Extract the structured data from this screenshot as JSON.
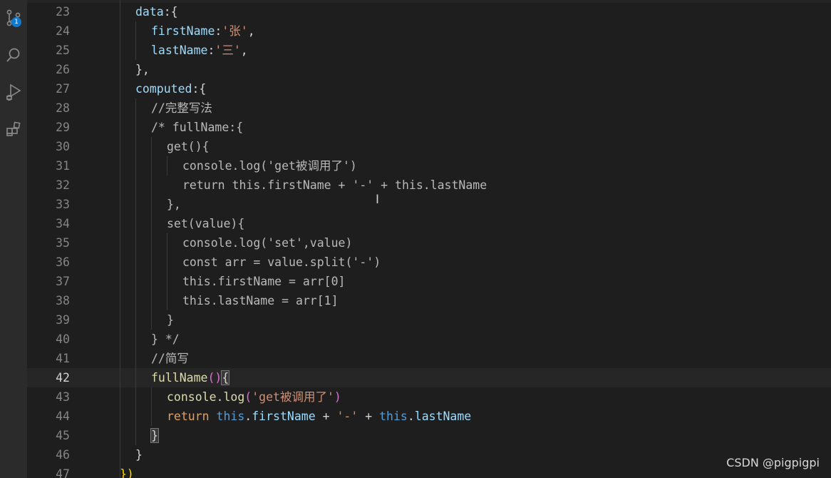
{
  "activity_bar": {
    "scm_badge": "1",
    "icons": [
      "source-control-icon",
      "search-icon",
      "run-debug-icon",
      "extensions-icon"
    ]
  },
  "editor": {
    "active_line": "42",
    "lines": [
      {
        "n": "23",
        "tokens": [
          {
            "t": "data",
            "c": "p"
          },
          {
            "t": ":{",
            "c": "pl"
          }
        ]
      },
      {
        "n": "24",
        "tokens": [
          {
            "t": "firstName",
            "c": "p"
          },
          {
            "t": ":",
            "c": "pl"
          },
          {
            "t": "'张'",
            "c": "s"
          },
          {
            "t": ",",
            "c": "pl"
          }
        ]
      },
      {
        "n": "25",
        "tokens": [
          {
            "t": "lastName",
            "c": "p"
          },
          {
            "t": ":",
            "c": "pl"
          },
          {
            "t": "'三'",
            "c": "s"
          },
          {
            "t": ",",
            "c": "pl"
          }
        ]
      },
      {
        "n": "26",
        "tokens": [
          {
            "t": "},",
            "c": "pl"
          }
        ]
      },
      {
        "n": "27",
        "tokens": [
          {
            "t": "computed",
            "c": "p"
          },
          {
            "t": ":{",
            "c": "pl"
          }
        ]
      },
      {
        "n": "28",
        "tokens": [
          {
            "t": "//完整写法",
            "c": "dim"
          }
        ]
      },
      {
        "n": "29",
        "tokens": [
          {
            "t": "/* fullName:{",
            "c": "dim"
          }
        ]
      },
      {
        "n": "30",
        "tokens": [
          {
            "t": "get(){",
            "c": "dim"
          }
        ]
      },
      {
        "n": "31",
        "tokens": [
          {
            "t": "console.log('get被调用了')",
            "c": "dim"
          }
        ]
      },
      {
        "n": "32",
        "tokens": [
          {
            "t": "return this.firstName + '-' + this.lastName",
            "c": "dim"
          }
        ]
      },
      {
        "n": "33",
        "tokens": [
          {
            "t": "},",
            "c": "dim"
          }
        ]
      },
      {
        "n": "34",
        "tokens": [
          {
            "t": "set(value){",
            "c": "dim"
          }
        ]
      },
      {
        "n": "35",
        "tokens": [
          {
            "t": "console.log('set',value)",
            "c": "dim"
          }
        ]
      },
      {
        "n": "36",
        "tokens": [
          {
            "t": "const arr = value.split('-')",
            "c": "dim"
          }
        ]
      },
      {
        "n": "37",
        "tokens": [
          {
            "t": "this.firstName = arr[0]",
            "c": "dim"
          }
        ]
      },
      {
        "n": "38",
        "tokens": [
          {
            "t": "this.lastName = arr[1]",
            "c": "dim"
          }
        ]
      },
      {
        "n": "39",
        "tokens": [
          {
            "t": "}",
            "c": "dim"
          }
        ]
      },
      {
        "n": "40",
        "tokens": [
          {
            "t": "} */",
            "c": "dim"
          }
        ]
      },
      {
        "n": "41",
        "tokens": [
          {
            "t": "//简写",
            "c": "dim"
          }
        ]
      },
      {
        "n": "42",
        "tokens": [
          {
            "t": "fullName",
            "c": "f"
          },
          {
            "t": "()",
            "c": "mg"
          },
          {
            "t": "{",
            "c": "bm"
          }
        ]
      },
      {
        "n": "43",
        "tokens": [
          {
            "t": "console",
            "c": "f"
          },
          {
            "t": ".",
            "c": "pl"
          },
          {
            "t": "log",
            "c": "f"
          },
          {
            "t": "(",
            "c": "mg"
          },
          {
            "t": "'get被调用了'",
            "c": "s"
          },
          {
            "t": ")",
            "c": "mg"
          }
        ]
      },
      {
        "n": "44",
        "tokens": [
          {
            "t": "return",
            "c": "ctl"
          },
          {
            "t": " ",
            "c": "pl"
          },
          {
            "t": "this",
            "c": "v"
          },
          {
            "t": ".",
            "c": "pl"
          },
          {
            "t": "firstName",
            "c": "p"
          },
          {
            "t": " + ",
            "c": "pl"
          },
          {
            "t": "'-'",
            "c": "s"
          },
          {
            "t": " + ",
            "c": "pl"
          },
          {
            "t": "this",
            "c": "v"
          },
          {
            "t": ".",
            "c": "pl"
          },
          {
            "t": "lastName",
            "c": "p"
          }
        ]
      },
      {
        "n": "45",
        "tokens": [
          {
            "t": "}",
            "c": "bm"
          }
        ]
      },
      {
        "n": "46",
        "tokens": [
          {
            "t": "}",
            "c": "pl"
          }
        ]
      },
      {
        "n": "47",
        "tokens": [
          {
            "t": "})",
            "c": "y"
          }
        ]
      }
    ]
  },
  "watermark": "CSDN @pigpigpi",
  "colors": {
    "background": "#1e1e1e",
    "activity_bar": "#2b2b2b",
    "badge": "#0e7ad0",
    "current_line": "#262626"
  }
}
